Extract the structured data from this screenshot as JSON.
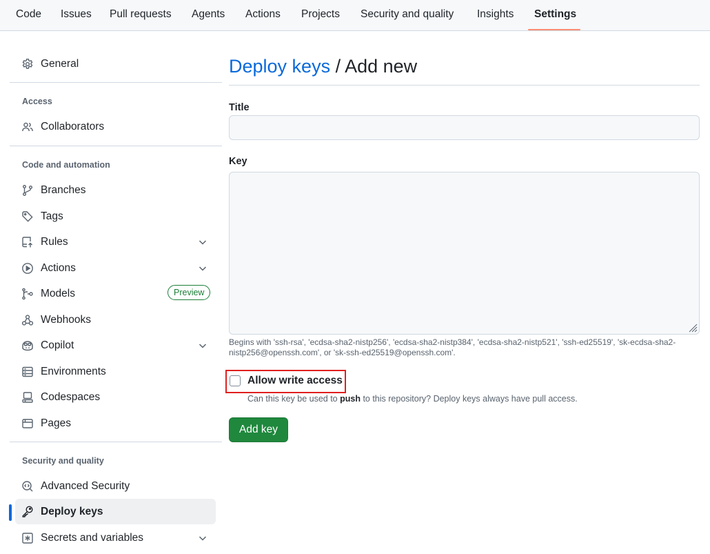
{
  "topnav": {
    "tabs": [
      {
        "label": "Code"
      },
      {
        "label": "Issues"
      },
      {
        "label": "Pull requests"
      },
      {
        "label": "Agents"
      },
      {
        "label": "Actions"
      },
      {
        "label": "Projects"
      },
      {
        "label": "Security and quality"
      },
      {
        "label": "Insights"
      },
      {
        "label": "Settings",
        "active": true
      }
    ],
    "active_color": "#fd8c73"
  },
  "sidebar": {
    "general": {
      "label": "General",
      "icon": "gear-icon"
    },
    "sections": [
      {
        "heading": "Access",
        "items": [
          {
            "label": "Collaborators",
            "icon": "people-icon"
          }
        ]
      },
      {
        "heading": "Code and automation",
        "items": [
          {
            "label": "Branches",
            "icon": "git-branch-icon"
          },
          {
            "label": "Tags",
            "icon": "tag-icon"
          },
          {
            "label": "Rules",
            "icon": "repo-push-icon",
            "expandable": true
          },
          {
            "label": "Actions",
            "icon": "play-icon",
            "expandable": true
          },
          {
            "label": "Models",
            "icon": "ai-model-icon",
            "badge": "Preview"
          },
          {
            "label": "Webhooks",
            "icon": "webhook-icon"
          },
          {
            "label": "Copilot",
            "icon": "copilot-icon",
            "expandable": true
          },
          {
            "label": "Environments",
            "icon": "server-icon"
          },
          {
            "label": "Codespaces",
            "icon": "codespaces-icon"
          },
          {
            "label": "Pages",
            "icon": "browser-icon"
          }
        ]
      },
      {
        "heading": "Security and quality",
        "items": [
          {
            "label": "Advanced Security",
            "icon": "codescan-icon"
          },
          {
            "label": "Deploy keys",
            "icon": "key-icon",
            "active": true
          },
          {
            "label": "Secrets and variables",
            "icon": "asterisk-icon",
            "expandable": true
          }
        ]
      }
    ],
    "active_indicator_color": "#0969da"
  },
  "main": {
    "breadcrumb_link": "Deploy keys",
    "breadcrumb_separator": " / ",
    "breadcrumb_current": "Add new",
    "title_field": {
      "label": "Title",
      "value": "",
      "placeholder": ""
    },
    "key_field": {
      "label": "Key",
      "value": "",
      "placeholder": ""
    },
    "key_help": "Begins with 'ssh-rsa', 'ecdsa-sha2-nistp256', 'ecdsa-sha2-nistp384', 'ecdsa-sha2-nistp521', 'ssh-ed25519', 'sk-ecdsa-sha2-nistp256@openssh.com', or 'sk-ssh-ed25519@openssh.com'.",
    "write_access": {
      "label": "Allow write access",
      "checked": false,
      "desc_before": "Can this key be used to ",
      "desc_bold": "push",
      "desc_after": " to this repository? Deploy keys always have pull access."
    },
    "submit_label": "Add key"
  },
  "colors": {
    "link": "#0969da",
    "primary_button": "#1f883d",
    "badge_green": "#1a7f37",
    "highlight_red": "#e01f1f"
  }
}
